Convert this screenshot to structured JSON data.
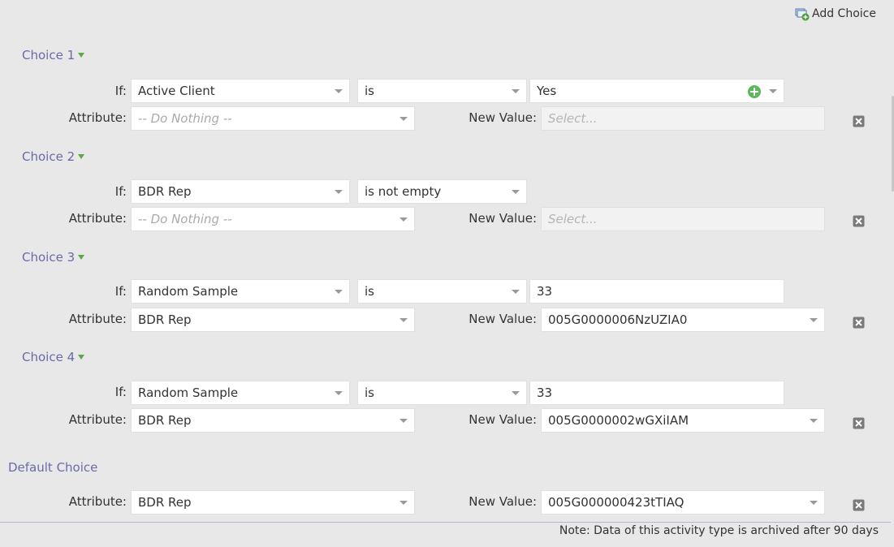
{
  "toolbar": {
    "add_choice_label": "Add Choice"
  },
  "labels": {
    "if": "If:",
    "attribute": "Attribute:",
    "new_value": "New Value:"
  },
  "choices": [
    {
      "title": "Choice 1",
      "if_field": "Active Client",
      "operator": "is",
      "value": "Yes",
      "attribute": "-- Do Nothing --",
      "new_value_placeholder": "Select..."
    },
    {
      "title": "Choice 2",
      "if_field": "BDR Rep",
      "operator": "is not empty",
      "attribute": "-- Do Nothing --",
      "new_value_placeholder": "Select..."
    },
    {
      "title": "Choice 3",
      "if_field": "Random Sample",
      "operator": "is",
      "value": "33",
      "attribute": "BDR Rep",
      "new_value": "005G0000006NzUZIA0"
    },
    {
      "title": "Choice 4",
      "if_field": "Random Sample",
      "operator": "is",
      "value": "33",
      "attribute": "BDR Rep",
      "new_value": "005G0000002wGXiIAM"
    }
  ],
  "default_choice": {
    "title": "Default Choice",
    "attribute": "BDR Rep",
    "new_value": "005G000000423tTIAQ"
  },
  "footer": {
    "note": "Note: Data of this activity type is archived after 90 days"
  },
  "icons": {
    "add_choice": "add-choice-icon",
    "expand": "triangle-down-icon",
    "plus": "plus-circle-icon",
    "delete": "delete-x-icon"
  },
  "colors": {
    "choice_header": "#6a6aaa",
    "plus_green": "#5cb85c",
    "triangle_green": "#5aa84a"
  }
}
